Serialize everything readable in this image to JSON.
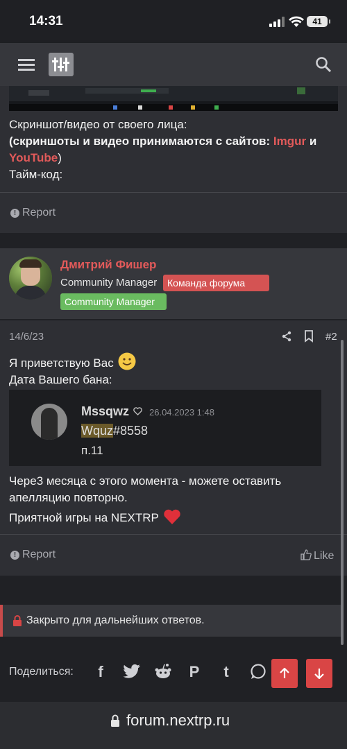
{
  "status_bar": {
    "time": "14:31",
    "battery": "41"
  },
  "post1": {
    "screenshot_label": "Скриншот/видео от своего лица:",
    "accepted_prefix": "(скриншоты и видео принимаются с сайтов:",
    "imgur": "Imgur",
    "and": "и",
    "youtube": "YouTube",
    "close_paren": ")",
    "timecode": "Тайм-код:",
    "report_label": "Report"
  },
  "post2": {
    "author_name": "Дмитрий Фишер",
    "author_title": "Community Manager",
    "badges": [
      {
        "label": "Команда форума",
        "color": "#d45353"
      },
      {
        "label": "Community Manager",
        "color": "#6abb60"
      }
    ],
    "date": "14/6/23",
    "post_number": "#2",
    "greeting": "Я приветствую Вас",
    "ban_date_label": "Дата Вашего бана:",
    "quote": {
      "username": "Mssqwz",
      "timestamp": "26.04.2023 1:48",
      "line1_highlight": "Wquz",
      "line1_rest": "#8558",
      "line2": "п.11"
    },
    "appeal_text": "Чере3 месяца с этого момента - можете оставить апелляцию повторно.",
    "closing": "Приятной игры на NEXTRP",
    "report_label": "Report",
    "like_label": "Like"
  },
  "locked_notice": "Закрыто для дальнейших ответов.",
  "share": {
    "label": "Поделиться:"
  },
  "url_bar": {
    "url": "forum.nextrp.ru"
  },
  "colors": {
    "accent_red": "#e25a5a",
    "badge_green": "#6abb60",
    "card_bg": "#2e2f34",
    "page_bg": "#202125"
  }
}
